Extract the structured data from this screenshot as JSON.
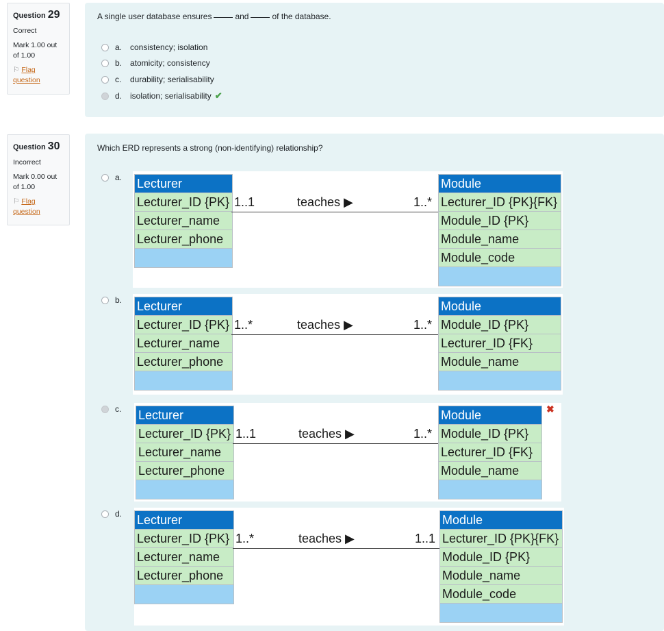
{
  "q29": {
    "label": "Question",
    "number": "29",
    "state": "Correct",
    "mark": "Mark 1.00 out of 1.00",
    "flag_label": "Flag question",
    "text_before": "A single user database ensures",
    "text_and": "and",
    "text_after": "of the database.",
    "options": [
      {
        "letter": "a.",
        "text": "consistency; isolation"
      },
      {
        "letter": "b.",
        "text": "atomicity; consistency"
      },
      {
        "letter": "c.",
        "text": "durability; serialisability"
      },
      {
        "letter": "d.",
        "text": "isolation; serialisability"
      }
    ],
    "selected": "d",
    "correct_indicator": "check-icon"
  },
  "q30": {
    "label": "Question",
    "number": "30",
    "state": "Incorrect",
    "mark": "Mark 0.00 out of 1.00",
    "flag_label": "Flag question",
    "text": "Which ERD represents a strong (non-identifying) relationship?",
    "selected": "c",
    "incorrect_indicator": "cross-icon",
    "options": [
      {
        "letter": "a.",
        "left": {
          "name": "Lecturer",
          "attrs": [
            "Lecturer_ID {PK}",
            "Lecturer_name",
            "Lecturer_phone"
          ]
        },
        "left_mult": "1..1",
        "relationship": "teaches ▶",
        "right_mult": "1..*",
        "right": {
          "name": "Module",
          "attrs": [
            "Lecturer_ID {PK}{FK}",
            "Module_ID {PK}",
            "Module_name",
            "Module_code"
          ]
        }
      },
      {
        "letter": "b.",
        "left": {
          "name": "Lecturer",
          "attrs": [
            "Lecturer_ID {PK}",
            "Lecturer_name",
            "Lecturer_phone"
          ]
        },
        "left_mult": "1..*",
        "relationship": "teaches ▶",
        "right_mult": "1..*",
        "right": {
          "name": "Module",
          "attrs": [
            "Module_ID {PK}",
            "Lecturer_ID {FK}",
            "Module_name"
          ]
        }
      },
      {
        "letter": "c.",
        "left": {
          "name": "Lecturer",
          "attrs": [
            "Lecturer_ID {PK}",
            "Lecturer_name",
            "Lecturer_phone"
          ]
        },
        "left_mult": "1..1",
        "relationship": "teaches ▶",
        "right_mult": "1..*",
        "right": {
          "name": "Module",
          "attrs": [
            "Module_ID {PK}",
            "Lecturer_ID {FK}",
            "Module_name"
          ]
        }
      },
      {
        "letter": "d.",
        "left": {
          "name": "Lecturer",
          "attrs": [
            "Lecturer_ID {PK}",
            "Lecturer_name",
            "Lecturer_phone"
          ]
        },
        "left_mult": "1..*",
        "relationship": "teaches ▶",
        "right_mult": "1..1",
        "right": {
          "name": "Module",
          "attrs": [
            "Lecturer_ID {PK}{FK}",
            "Module_ID {PK}",
            "Module_name",
            "Module_code"
          ]
        }
      }
    ]
  },
  "colors": {
    "entity_header": "#0c72c5",
    "attribute_fill": "#c8ecc6",
    "empty_row_fill": "#9bd2f4",
    "question_bg": "#e7f3f5",
    "correct": "#4aa14a",
    "incorrect": "#ca3120",
    "flag_link": "#c66a1c"
  }
}
